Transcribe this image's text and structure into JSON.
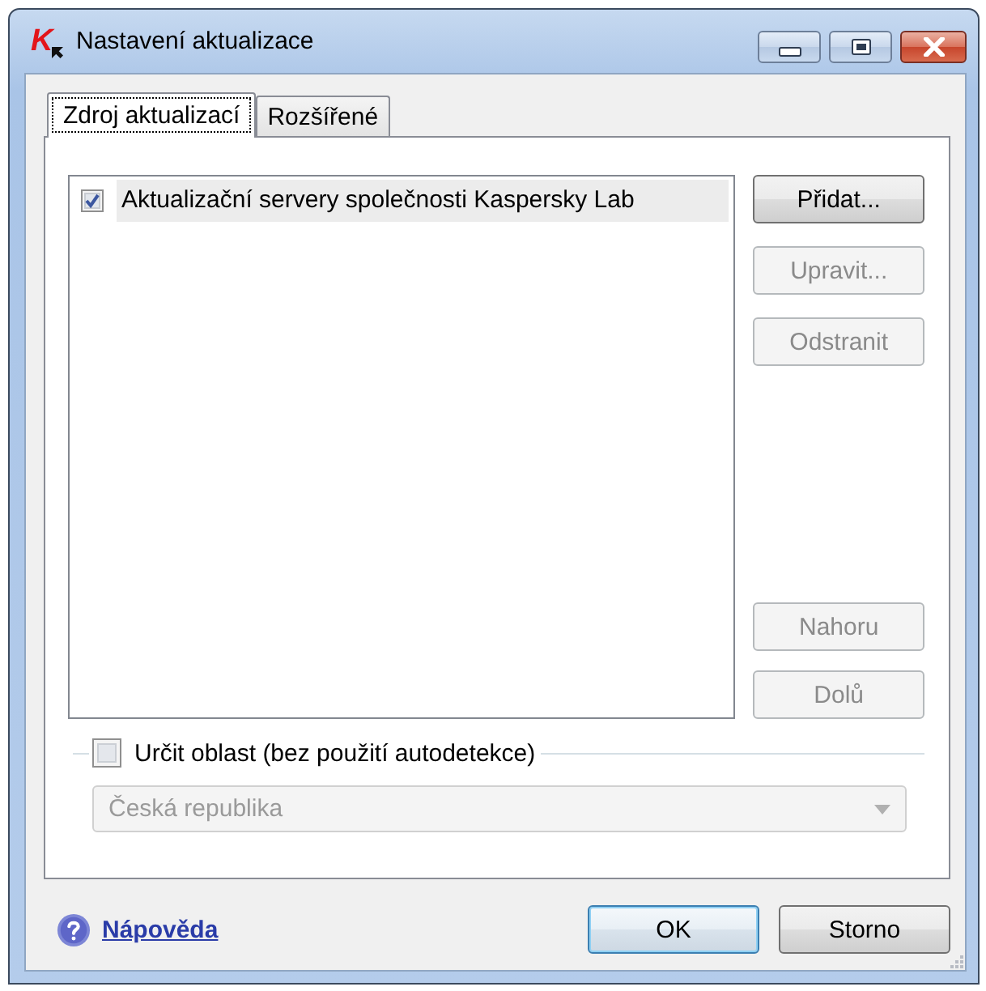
{
  "window": {
    "logo": "K",
    "title": "Nastavení aktualizace"
  },
  "tabs": [
    {
      "label": "Zdroj aktualizací",
      "selected": true
    },
    {
      "label": "Rozšířené",
      "selected": false
    }
  ],
  "sources": [
    {
      "label": "Aktualizační servery společnosti Kaspersky Lab",
      "checked": true,
      "selected": true
    }
  ],
  "edit_buttons": [
    {
      "label": "Přidat...",
      "disabled": false
    },
    {
      "label": "Upravit...",
      "disabled": true
    },
    {
      "label": "Odstranit",
      "disabled": true
    }
  ],
  "move_buttons": [
    {
      "label": "Nahoru",
      "disabled": true
    },
    {
      "label": "Dolů",
      "disabled": true
    }
  ],
  "region": {
    "label": "Určit oblast (bez použití autodetekce)",
    "checked": false,
    "dropdown": {
      "value": "Česká republika",
      "disabled": true
    }
  },
  "footer": {
    "help_link": "Nápověda",
    "buttons": [
      {
        "label": "OK",
        "default": true
      },
      {
        "label": "Storno",
        "default": false
      }
    ]
  }
}
